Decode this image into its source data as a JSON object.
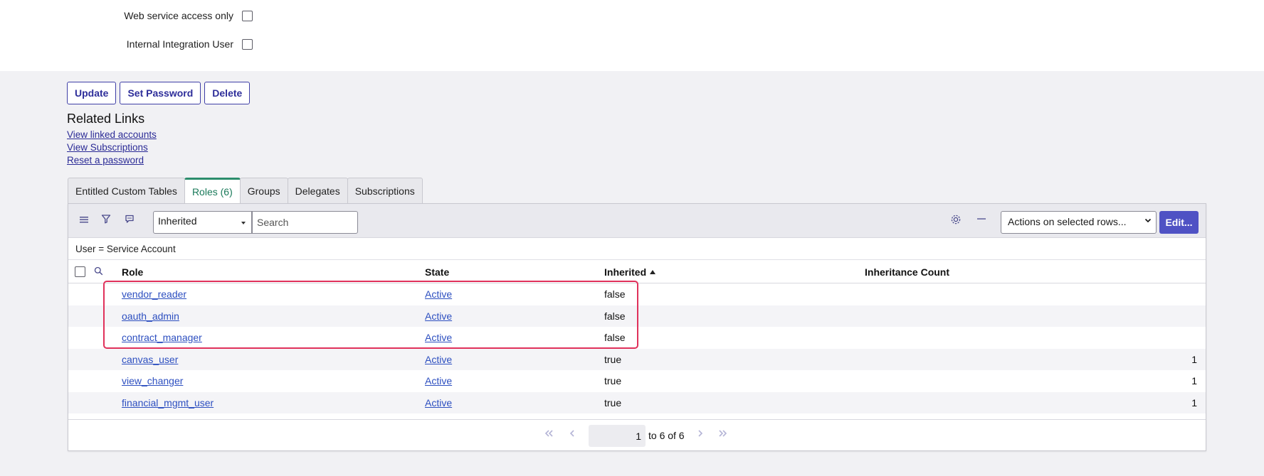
{
  "form": {
    "web_service_label": "Web service access only",
    "internal_integration_label": "Internal Integration User"
  },
  "buttons": {
    "update": "Update",
    "set_password": "Set Password",
    "delete": "Delete"
  },
  "related": {
    "title": "Related Links",
    "links": [
      "View linked accounts",
      "View Subscriptions",
      "Reset a password"
    ]
  },
  "tabs": [
    {
      "label": "Entitled Custom Tables",
      "active": false
    },
    {
      "label": "Roles (6)",
      "active": true
    },
    {
      "label": "Groups",
      "active": false
    },
    {
      "label": "Delegates",
      "active": false
    },
    {
      "label": "Subscriptions",
      "active": false
    }
  ],
  "toolbar": {
    "field_select": "Inherited",
    "search_placeholder": "Search",
    "actions_select": "Actions on selected rows...",
    "edit_label": "Edit..."
  },
  "filter_breadcrumb": "User = Service Account",
  "columns": {
    "role": "Role",
    "state": "State",
    "inherited": "Inherited",
    "inheritance_count": "Inheritance Count"
  },
  "rows": [
    {
      "role": "vendor_reader",
      "state": "Active",
      "inherited": "false",
      "count": ""
    },
    {
      "role": "oauth_admin",
      "state": "Active",
      "inherited": "false",
      "count": ""
    },
    {
      "role": "contract_manager",
      "state": "Active",
      "inherited": "false",
      "count": ""
    },
    {
      "role": "canvas_user",
      "state": "Active",
      "inherited": "true",
      "count": "1"
    },
    {
      "role": "view_changer",
      "state": "Active",
      "inherited": "true",
      "count": "1"
    },
    {
      "role": "financial_mgmt_user",
      "state": "Active",
      "inherited": "true",
      "count": "1"
    }
  ],
  "pagination": {
    "page_value": "1",
    "range_text": "to 6 of 6"
  },
  "colors": {
    "primary": "#4f52c4",
    "link": "#2d4fc0",
    "active_tab": "#2c8d6c",
    "highlight": "#e0315b"
  }
}
